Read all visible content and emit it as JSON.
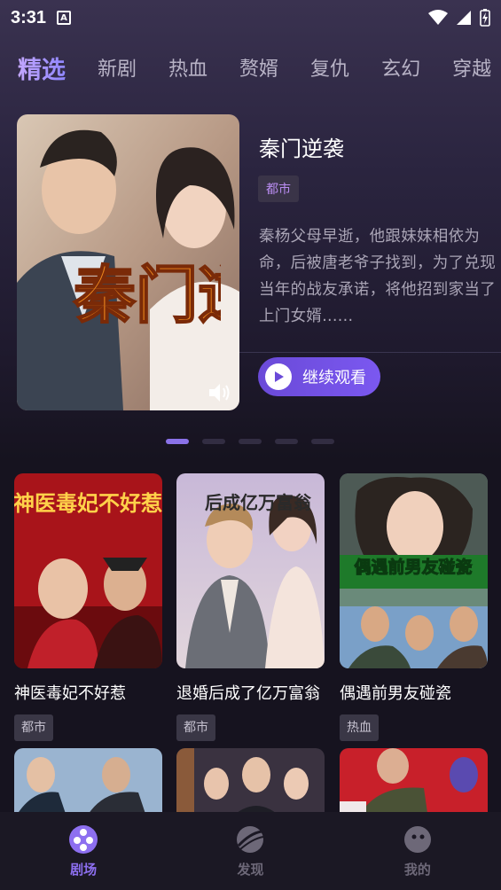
{
  "status_bar": {
    "time": "3:31",
    "notification_letter": "A"
  },
  "tabs": [
    {
      "label": "精选",
      "active": true
    },
    {
      "label": "新剧"
    },
    {
      "label": "热血"
    },
    {
      "label": "赘婿"
    },
    {
      "label": "复仇"
    },
    {
      "label": "玄幻"
    },
    {
      "label": "穿越"
    }
  ],
  "featured": {
    "title": "秦门逆袭",
    "tag": "都市",
    "description": "秦杨父母早逝，他跟妹妹相依为命，后被唐老爷子找到，为了兑现当年的战友承诺，将他招到家当了上门女婿......",
    "poster_text": "秦门逆袭",
    "play_label": "继续观看"
  },
  "carousel": {
    "count": 5,
    "active_index": 0
  },
  "grid": [
    {
      "title": "神医毒妃不好惹",
      "tag": "都市",
      "poster_text": "神医毒妃不好惹"
    },
    {
      "title": "退婚后成了亿万富翁",
      "tag": "都市",
      "poster_text": "后成亿万富翁"
    },
    {
      "title": "偶遇前男友碰瓷",
      "tag": "热血",
      "poster_text": "偶遇前男友碰瓷"
    }
  ],
  "bottom_nav": [
    {
      "label": "剧场",
      "icon": "theater-reel-icon",
      "active": true
    },
    {
      "label": "发现",
      "icon": "planet-icon"
    },
    {
      "label": "我的",
      "icon": "profile-face-icon"
    }
  ],
  "colors": {
    "accent": "#8d6ff0",
    "tag_purple": "#b98cf0",
    "background": "#16131f"
  }
}
